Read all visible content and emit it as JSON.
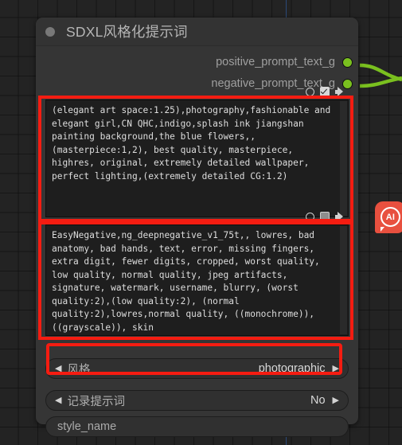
{
  "canvas": {
    "background_color": "#232323",
    "grid_color": "#000000",
    "axis_line_color": "#2b4a7a"
  },
  "node": {
    "title": "SDXL风格化提示词",
    "collapse_dot": "collapse-dot",
    "title_color": "#b6b6b6",
    "body_color": "#353535",
    "outputs": [
      {
        "label": "positive_prompt_text_g",
        "dot_color": "#7ac01f",
        "connected": true
      },
      {
        "label": "negative_prompt_text_g",
        "dot_color": "#7ac01f",
        "connected": true
      }
    ],
    "textareas": [
      {
        "name": "positive-prompt",
        "value": "(elegant art space:1.25),photography,fashionable and elegant girl,CN QHC,indigo,splash ink jiangshan painting background,the blue flowers,,(masterpiece:1,2), best quality, masterpiece, highres, original, extremely detailed wallpaper, perfect lighting,(extremely detailed CG:1.2)",
        "toolbar_icons": [
          "record-circle-icon",
          "checkbox-checked-icon",
          "speaker-icon"
        ],
        "checkbox_checked": true
      },
      {
        "name": "negative-prompt",
        "value": "EasyNegative,ng_deepnegative_v1_75t,, lowres, bad anatomy, bad hands, text, error, missing fingers, extra digit, fewer digits, cropped, worst quality, low quality, normal quality, jpeg artifacts, signature, watermark, username, blurry, (worst quality:2),(low quality:2), (normal quality:2),lowres,normal quality, ((monochrome)), ((grayscale)), skin",
        "toolbar_icons": [
          "record-circle-icon",
          "checkbox-unchecked-icon",
          "speaker-icon"
        ],
        "checkbox_checked": false
      }
    ],
    "widgets": [
      {
        "name": "style",
        "label": "风格",
        "value": "photographic",
        "left_arrow": "◀",
        "right_arrow": "▶",
        "highlighted": true
      },
      {
        "name": "log-prompt",
        "label": "记录提示词",
        "value": "No",
        "left_arrow": "◀",
        "right_arrow": "▶",
        "highlighted": false
      },
      {
        "name": "style-name",
        "placeholder": "style_name",
        "value": "",
        "highlighted": false
      }
    ]
  },
  "annotations": {
    "highlight_color": "#f51c11",
    "boxes": [
      {
        "name": "positive-prompt-highlight"
      },
      {
        "name": "negative-prompt-highlight"
      },
      {
        "name": "style-widget-highlight"
      }
    ]
  },
  "ai_badge": {
    "label": "AI",
    "color": "#e8503f"
  }
}
